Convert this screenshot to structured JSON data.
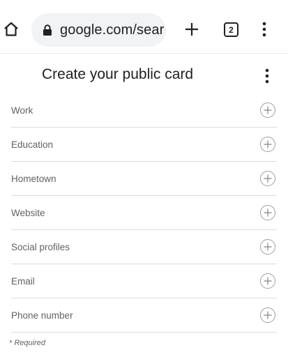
{
  "browser": {
    "url": "google.com/sear",
    "tab_count": "2"
  },
  "page": {
    "title": "Create your public card",
    "fields": [
      {
        "label": "Work"
      },
      {
        "label": "Education"
      },
      {
        "label": "Hometown"
      },
      {
        "label": "Website"
      },
      {
        "label": "Social profiles"
      },
      {
        "label": "Email"
      },
      {
        "label": "Phone number"
      }
    ],
    "required_note": "* Required"
  },
  "icons": {
    "home": "home-icon",
    "lock": "lock-icon",
    "new_tab": "plus-icon",
    "menu": "more-vert-icon",
    "add_field": "add-circle-icon"
  },
  "colors": {
    "text_primary": "#202124",
    "text_secondary": "#5f6368",
    "url_pill": "#f1f3f4",
    "divider": "#dadce0",
    "icon_outline": "#9aa0a6"
  }
}
